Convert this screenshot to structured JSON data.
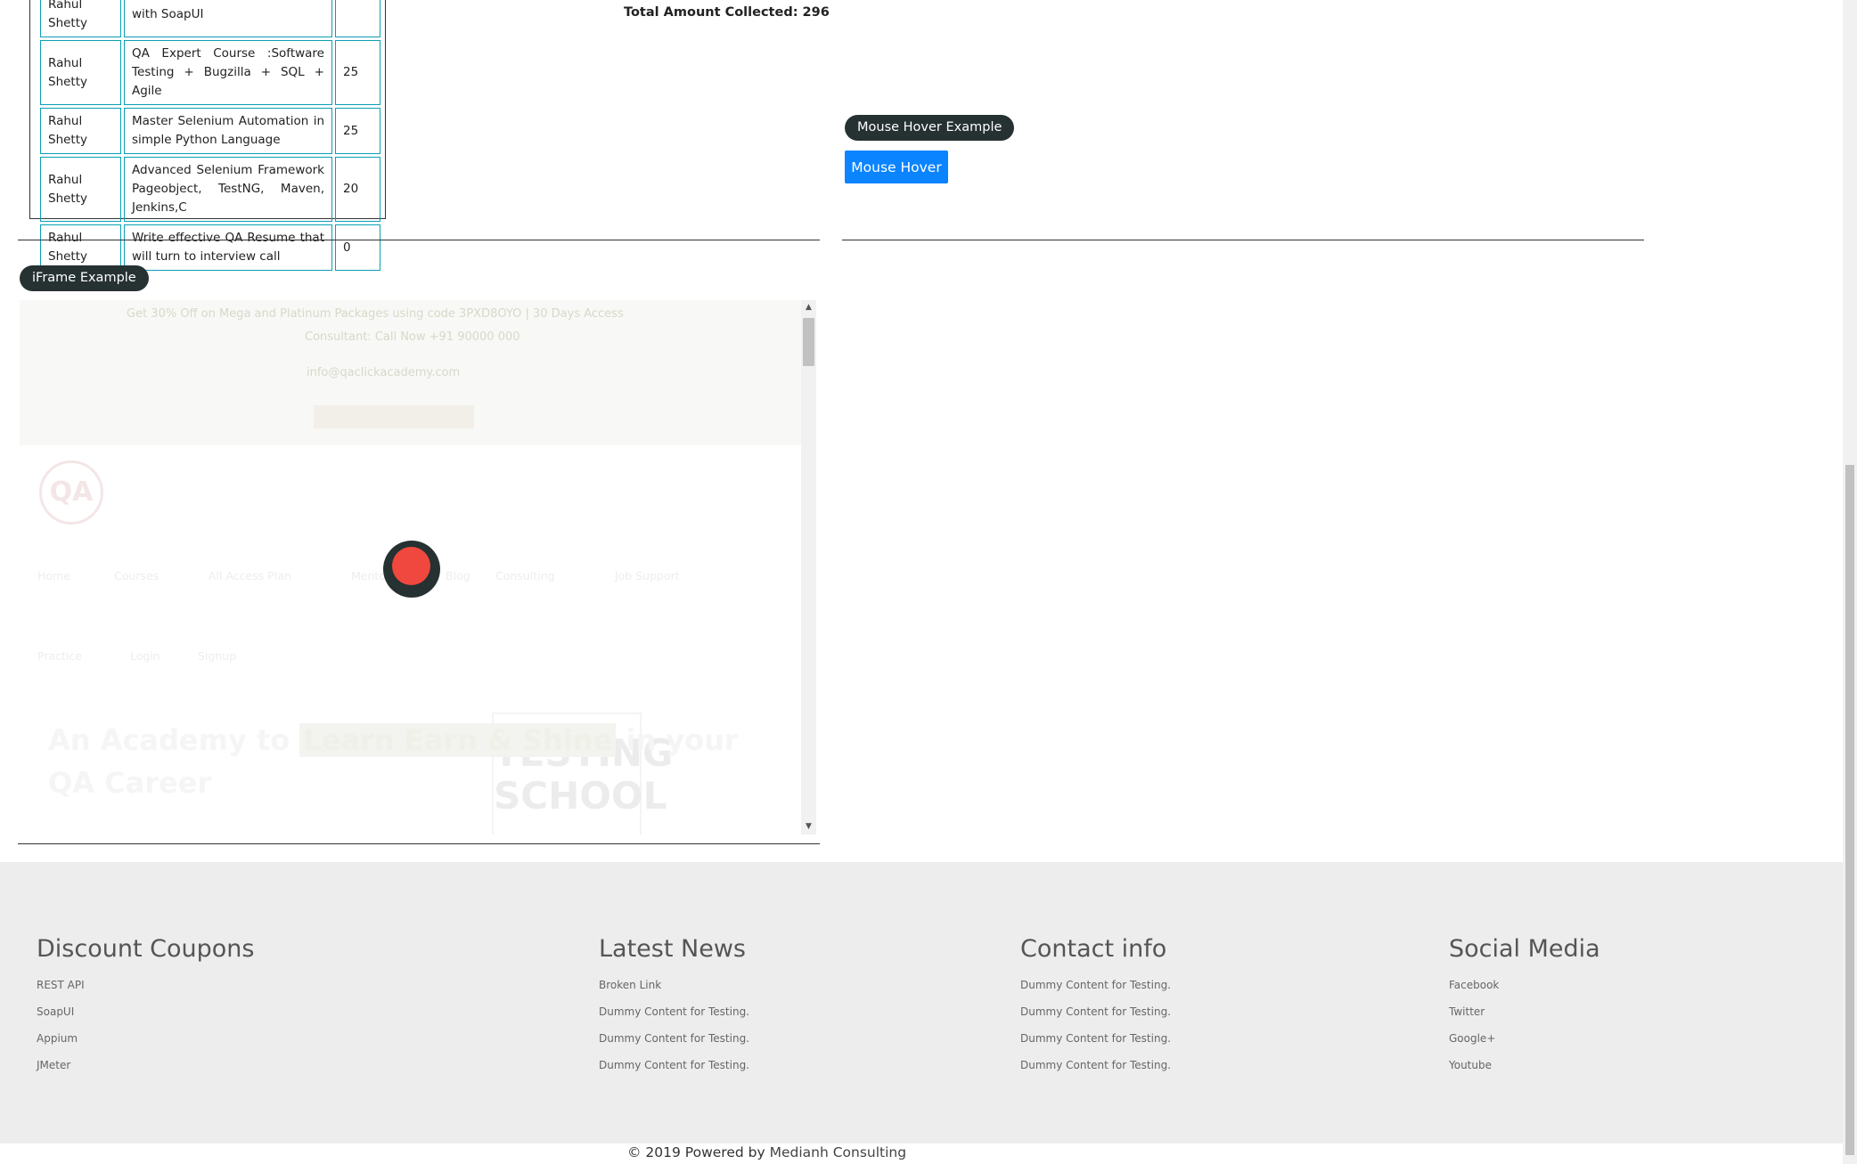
{
  "course_table": {
    "rows": [
      {
        "instructor": "Rahul Shetty",
        "course": "with SoapUI",
        "price": ""
      },
      {
        "instructor": "Rahul Shetty",
        "course": "QA Expert Course :Software Testing + Bugzilla + SQL + Agile",
        "price": "25"
      },
      {
        "instructor": "Rahul Shetty",
        "course": "Master Selenium Automation in simple Python Language",
        "price": "25"
      },
      {
        "instructor": "Rahul Shetty",
        "course": "Advanced Selenium Framework Pageobject, TestNG, Maven, Jenkins,C",
        "price": "20"
      },
      {
        "instructor": "Rahul Shetty",
        "course": "Write effective QA Resume that will turn to interview call",
        "price": "0"
      }
    ]
  },
  "total_amount": "Total Amount Collected: 296",
  "mouse_hover": {
    "legend": "Mouse Hover Example",
    "button_label": "Mouse Hover"
  },
  "iframe_section": {
    "legend": "iFrame Example",
    "banner_line1": "Get 30% Off on Mega and Platinum Packages using code 3PXD8OYO | 30 Days Access",
    "banner_line2": "Consultant: Call Now +91 90000 000",
    "banner_line3": "info@qaclickacademy.com",
    "nav_items": [
      "Home",
      "Courses",
      "All Access Plan",
      "Mentorship",
      "Blog",
      "Consulting",
      "Job Support"
    ],
    "nav_items_2": [
      "Practice",
      "Login",
      "Signup"
    ],
    "heading_part1": "An Academy to",
    "heading_highlight": "Learn Earn & Shine",
    "heading_part2": "in your QA Career",
    "school_text": "TESTING SCHOOL",
    "logo_text": "QA"
  },
  "footer": {
    "columns": [
      {
        "title": "Discount Coupons",
        "links": [
          "REST API",
          "SoapUI",
          "Appium",
          "JMeter"
        ]
      },
      {
        "title": "Latest News",
        "links": [
          "Broken Link",
          "Dummy Content for Testing.",
          "Dummy Content for Testing.",
          "Dummy Content for Testing."
        ]
      },
      {
        "title": "Contact info",
        "links": [
          "Dummy Content for Testing.",
          "Dummy Content for Testing.",
          "Dummy Content for Testing.",
          "Dummy Content for Testing."
        ]
      },
      {
        "title": "Social Media",
        "links": [
          "Facebook",
          "Twitter",
          "Google+",
          "Youtube"
        ]
      }
    ],
    "copyright_prefix": "© 2019 Powered by",
    "copyright_company": "Medianh Consulting"
  },
  "colors": {
    "accent_blue": "#0b84ff",
    "pill_dark": "#263132",
    "table_border": "#0a9fb5",
    "footer_bg": "#ededed",
    "loader_red": "#f0483e"
  },
  "icons": {
    "iframe_scroll_up": "triangle-up",
    "iframe_scroll_down": "triangle-down",
    "loader": "loading-spinner"
  }
}
